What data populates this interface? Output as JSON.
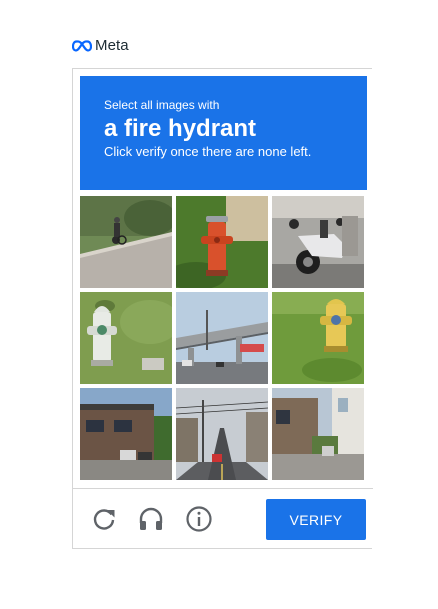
{
  "brand": {
    "name": "Meta",
    "logo_icon": "meta-infinity-icon"
  },
  "captcha": {
    "instruction_prefix": "Select all images with",
    "target": "a fire hydrant",
    "instruction_suffix": "Click verify once there are none left.",
    "tiles": [
      {
        "label": "cyclist on road"
      },
      {
        "label": "red fire hydrant"
      },
      {
        "label": "motorcycle"
      },
      {
        "label": "white fire hydrant"
      },
      {
        "label": "highway overpass"
      },
      {
        "label": "yellow fire hydrant"
      },
      {
        "label": "building street"
      },
      {
        "label": "city street"
      },
      {
        "label": "house street"
      }
    ],
    "controls": {
      "reload_icon": "reload-icon",
      "audio_icon": "headphones-icon",
      "info_icon": "info-icon",
      "verify_label": "VERIFY"
    },
    "colors": {
      "accent": "#1a73e8",
      "icon_gray": "#5f6368"
    }
  }
}
